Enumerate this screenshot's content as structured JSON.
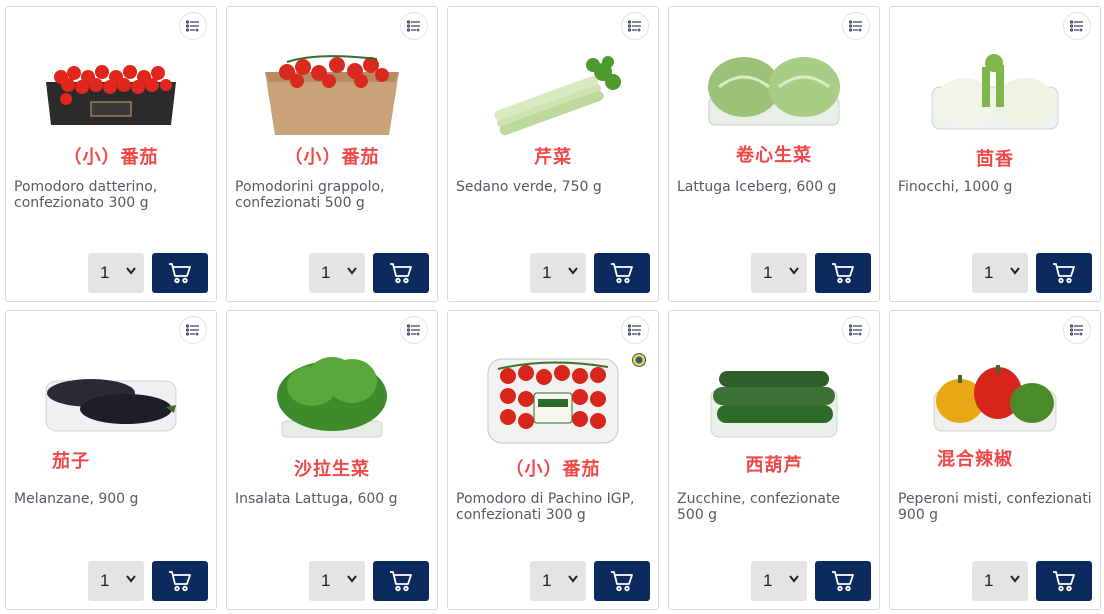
{
  "accent": "#0d2a5e",
  "label_color": "#f04848",
  "products": [
    {
      "cn": "（小）番茄",
      "name": "Pomodoro datterino, confezionato 300 g",
      "qty": "1",
      "image": "cherry-tomato-box"
    },
    {
      "cn": "（小）番茄",
      "name": "Pomodorini grappolo, confezionati 500 g",
      "qty": "1",
      "image": "vine-tomato-cardboard"
    },
    {
      "cn": "芹菜",
      "name": "Sedano verde, 750 g",
      "qty": "1",
      "image": "celery"
    },
    {
      "cn": "卷心生菜",
      "name": "Lattuga Iceberg, 600 g",
      "qty": "1",
      "image": "iceberg-lettuce"
    },
    {
      "cn": "茴香",
      "name": "Finocchi, 1000 g",
      "qty": "1",
      "image": "fennel"
    },
    {
      "cn": "茄子",
      "name": "Melanzane, 900 g",
      "qty": "1",
      "image": "eggplant"
    },
    {
      "cn": "沙拉生菜",
      "name": "Insalata Lattuga, 600 g",
      "qty": "1",
      "image": "lettuce"
    },
    {
      "cn": "（小）番茄",
      "name": "Pomodoro di Pachino IGP, confezionati 300 g",
      "qty": "1",
      "image": "pachino-tomato"
    },
    {
      "cn": "西葫芦",
      "name": "Zucchine, confezionate 500 g",
      "qty": "1",
      "image": "zucchini"
    },
    {
      "cn": "混合辣椒",
      "name": "Peperoni misti, confezionati 900 g",
      "qty": "1",
      "image": "mixed-peppers"
    }
  ],
  "icons": {
    "list": "list-add-icon",
    "cart": "cart-icon",
    "chevron": "chevron-down-icon",
    "badge": "igp-badge-icon"
  }
}
